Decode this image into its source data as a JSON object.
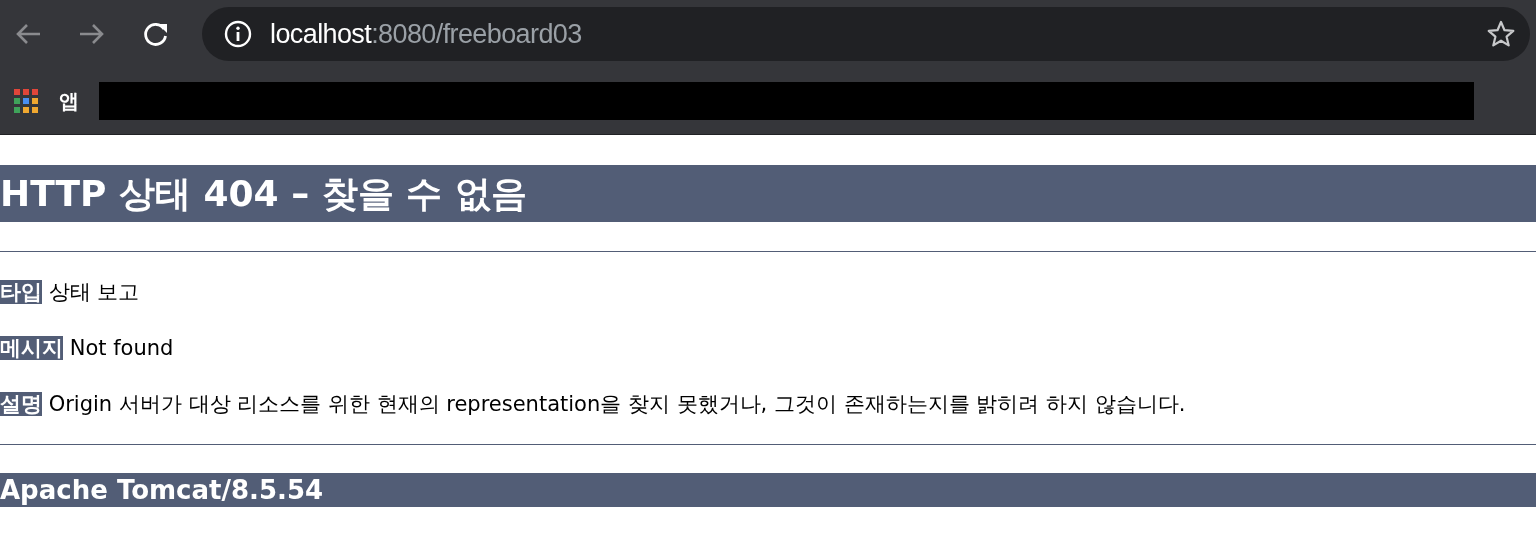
{
  "browser": {
    "address": {
      "host": "localhost",
      "path": ":8080/freeboard03"
    },
    "bookmarks": {
      "apps_label": "앱",
      "redacted": true
    }
  },
  "page": {
    "heading": "HTTP 상태 404 – 찾을 수 없음",
    "fields": [
      {
        "label": "타입",
        "value": "상태 보고"
      },
      {
        "label": "메시지",
        "value": "Not found"
      },
      {
        "label": "설명",
        "value": "Origin 서버가 대상 리소스를 위한 현재의 representation을 찾지 못했거나, 그것이 존재하는지를 밝히려 하지 않습니다."
      }
    ],
    "footer": "Apache Tomcat/8.5.54"
  }
}
